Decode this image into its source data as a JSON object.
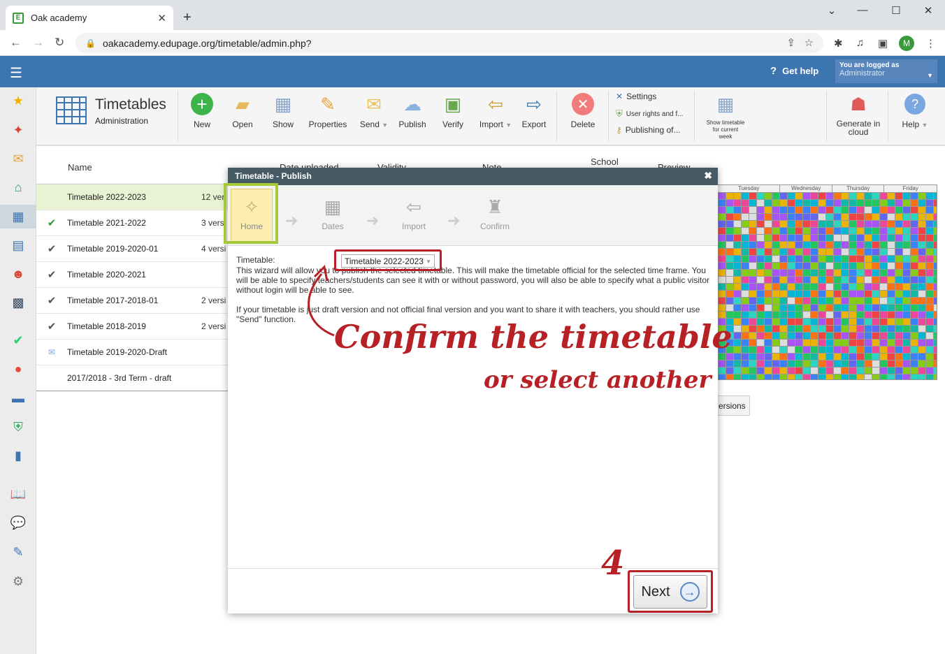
{
  "browser": {
    "tab_title": "Oak academy",
    "url": "oakacademy.edupage.org/timetable/admin.php?"
  },
  "appbar": {
    "get_help": "Get help",
    "logged_label": "You are logged as",
    "logged_user": "Administrator"
  },
  "ribbon": {
    "title": "Timetables",
    "subtitle": "Administration",
    "buttons": {
      "new": "New",
      "open": "Open",
      "show": "Show",
      "properties": "Properties",
      "send": "Send",
      "publish": "Publish",
      "verify": "Verify",
      "import": "Import",
      "export": "Export",
      "delete": "Delete",
      "settings": "Settings",
      "user_rights": "User rights and f...",
      "publishing": "Publishing of...",
      "show_timetable_1": "Show timetable",
      "show_timetable_2": "for current",
      "show_timetable_3": "week",
      "generate_1": "Generate in",
      "generate_2": "cloud",
      "help": "Help"
    }
  },
  "table": {
    "headers": {
      "name": "Name",
      "date_uploaded": "Date uploaded",
      "validity": "Validity",
      "note": "Note",
      "school": "School",
      "preview": "Preview"
    },
    "rows": [
      {
        "name": "Timetable 2022-2023",
        "versions": "12 ver",
        "status": ""
      },
      {
        "name": "Timetable 2021-2022",
        "versions": "3 vers",
        "status": "check-green"
      },
      {
        "name": "Timetable 2019-2020-01",
        "versions": "4 versi",
        "status": "check"
      },
      {
        "name": "Timetable 2020-2021",
        "versions": "",
        "status": "check"
      },
      {
        "name": "Timetable 2017-2018-01",
        "versions": "2 versi",
        "status": "check"
      },
      {
        "name": "Timetable 2018-2019",
        "versions": "2 versi",
        "status": "check"
      },
      {
        "name": "Timetable 2019-2020-Draft",
        "versions": "",
        "status": "mail"
      },
      {
        "name": "2017/2018 - 3rd Term - draft",
        "versions": "",
        "status": ""
      }
    ],
    "versions_button": "ersions"
  },
  "preview": {
    "days": [
      "Tuesday",
      "Wednesday",
      "Thursday",
      "Friday"
    ]
  },
  "dialog": {
    "title": "Timetable - Publish",
    "steps": {
      "home": "Home",
      "dates": "Dates",
      "import": "Import",
      "confirm": "Confirm"
    },
    "timetable_label": "Timetable:",
    "timetable_value": "Timetable 2022-2023",
    "para1": "This wizard will allow you to publish the selected timetable. This will make the timetable official for the selected time frame. You will be able to specify teachers/students can see it with or without password, you will also be able to specify what a public visitor without login will be able to see.",
    "para2": "If your timetable is just draft version and not official final version and you want to share it with teachers, you should rather use \"Send\" function.",
    "next_label": "Next"
  },
  "annotations": {
    "line1": "Confirm the timetable",
    "line2": "or select another",
    "step_number": "4"
  },
  "colors": {
    "appbar": "#3d75b1",
    "highlight_red": "#b72025",
    "highlight_green": "#a6c93a"
  }
}
